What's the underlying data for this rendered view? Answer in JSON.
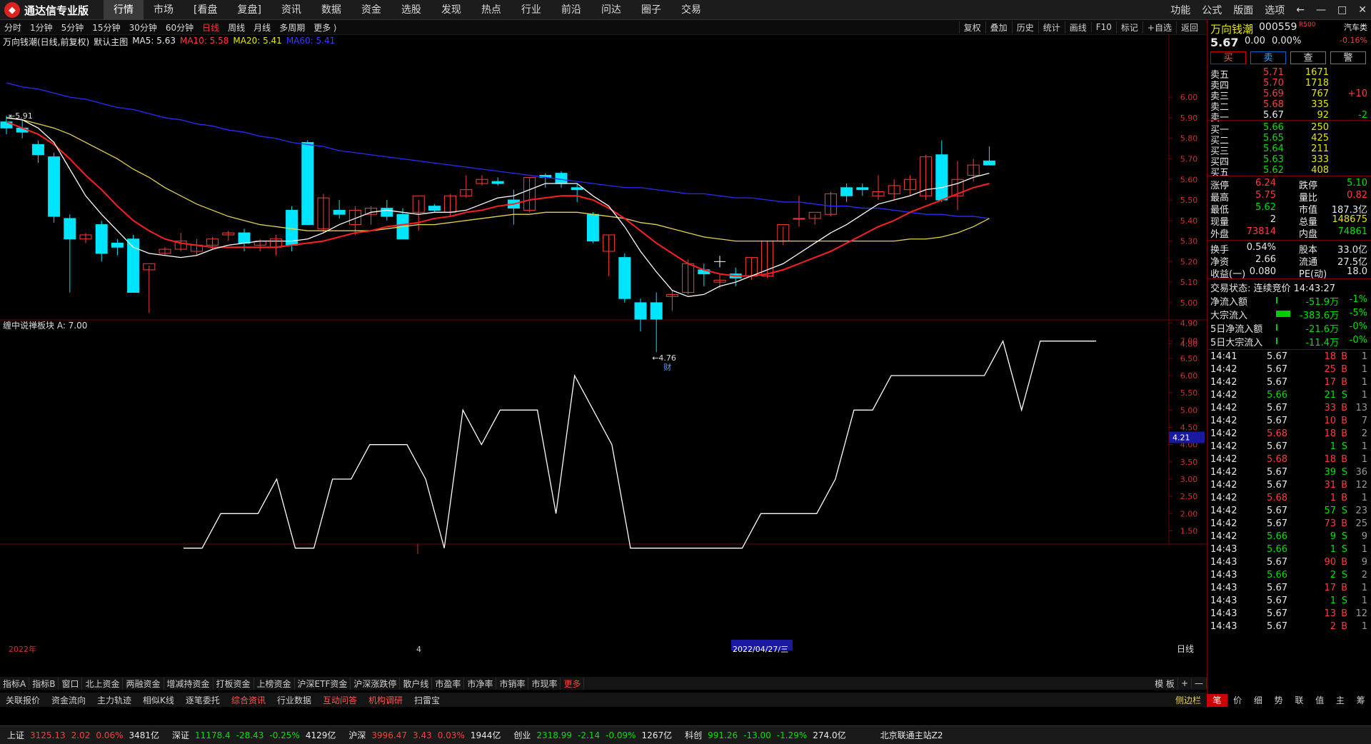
{
  "app": {
    "title": "通达信专业版"
  },
  "menu": [
    "行情",
    "市场",
    "[看盘",
    "复盘]",
    "资讯",
    "数据",
    "资金",
    "选股",
    "发现",
    "热点",
    "行业",
    "前沿",
    "问达",
    "圈子",
    "交易"
  ],
  "menu_active": "行情",
  "right_menu": [
    "功能",
    "公式",
    "版面",
    "选项",
    "←",
    "—",
    "□",
    "✕"
  ],
  "periods": [
    "分时",
    "1分钟",
    "5分钟",
    "15分钟",
    "30分钟",
    "60分钟",
    "日线",
    "周线",
    "月线",
    "多周期",
    "更多 ⟩"
  ],
  "period_active": "日线",
  "toolbar_right": [
    "复权",
    "叠加",
    "历史",
    "统计",
    "画线",
    "F10",
    "标记",
    "+自选",
    "返回"
  ],
  "chart_info": {
    "name": "万向钱潮(日线,前复权)",
    "main": "默认主图",
    "ma5": "MA5: 5.63",
    "ma10": "MA10: 5.58",
    "ma20": "MA20: 5.41",
    "ma60": "MA60: 5.41",
    "high_label": "5.91",
    "low_label": "4.76",
    "fin_mark": "财",
    "year_label": "2022年",
    "month_label": "4",
    "date_label": "2022/04/27/三",
    "period_label": "日线",
    "ind_title": "缠中说禅板块",
    "ind_value": "A: 7.00",
    "ind_cursor": "4.21"
  },
  "chart_data": [
    {
      "type": "candlestick",
      "title": "万向钱潮(日线,前复权)",
      "y_ticks": [
        "6.00",
        "5.90",
        "5.80",
        "5.70",
        "5.60",
        "5.50",
        "5.40",
        "5.30",
        "5.20",
        "5.10",
        "5.00",
        "4.90",
        "4.80"
      ],
      "ylim": [
        4.76,
        6.07
      ],
      "candles": [
        [
          5.88,
          5.91,
          5.82,
          5.85
        ],
        [
          5.85,
          5.89,
          5.8,
          5.83
        ],
        [
          5.77,
          5.79,
          5.68,
          5.72
        ],
        [
          5.71,
          5.73,
          5.39,
          5.42
        ],
        [
          5.41,
          5.43,
          5.05,
          5.31
        ],
        [
          5.31,
          5.34,
          5.29,
          5.33
        ],
        [
          5.38,
          5.4,
          5.2,
          5.24
        ],
        [
          5.29,
          5.31,
          5.23,
          5.27
        ],
        [
          5.31,
          5.33,
          5.05,
          5.05
        ],
        [
          5.16,
          5.18,
          4.95,
          5.19
        ],
        [
          5.24,
          5.27,
          5.23,
          5.26
        ],
        [
          5.26,
          5.34,
          5.25,
          5.3
        ],
        [
          5.25,
          5.31,
          5.23,
          5.28
        ],
        [
          5.28,
          5.32,
          5.26,
          5.31
        ],
        [
          5.33,
          5.35,
          5.3,
          5.34
        ],
        [
          5.34,
          5.36,
          5.25,
          5.29
        ],
        [
          5.28,
          5.31,
          5.25,
          5.3
        ],
        [
          5.27,
          5.33,
          5.23,
          5.31
        ],
        [
          5.45,
          5.47,
          5.25,
          5.28
        ],
        [
          5.78,
          5.79,
          5.38,
          5.38
        ],
        [
          5.36,
          5.53,
          5.34,
          5.51
        ],
        [
          5.45,
          5.5,
          5.41,
          5.43
        ],
        [
          5.38,
          5.47,
          5.33,
          5.45
        ],
        [
          5.43,
          5.47,
          5.38,
          5.46
        ],
        [
          5.46,
          5.5,
          5.4,
          5.42
        ],
        [
          5.43,
          5.46,
          5.31,
          5.31
        ],
        [
          5.44,
          5.5,
          5.35,
          5.52
        ],
        [
          5.47,
          5.48,
          5.44,
          5.45
        ],
        [
          5.44,
          5.53,
          5.42,
          5.52
        ],
        [
          5.52,
          5.62,
          5.51,
          5.55
        ],
        [
          5.58,
          5.62,
          5.57,
          5.6
        ],
        [
          5.59,
          5.61,
          5.57,
          5.58
        ],
        [
          5.5,
          5.55,
          5.38,
          5.46
        ],
        [
          5.45,
          5.61,
          5.44,
          5.61
        ],
        [
          5.62,
          5.63,
          5.56,
          5.61
        ],
        [
          5.63,
          5.64,
          5.56,
          5.58
        ],
        [
          5.56,
          5.58,
          5.49,
          5.55
        ],
        [
          5.43,
          5.44,
          5.29,
          5.3
        ],
        [
          5.25,
          5.33,
          5.13,
          5.33
        ],
        [
          5.22,
          5.24,
          5.0,
          5.02
        ],
        [
          5.0,
          5.02,
          4.86,
          4.92
        ],
        [
          5.0,
          5.05,
          4.76,
          4.92
        ],
        [
          5.03,
          5.06,
          4.96,
          5.04
        ],
        [
          5.05,
          5.21,
          5.04,
          5.19
        ],
        [
          5.16,
          5.19,
          5.08,
          5.14
        ],
        [
          5.1,
          5.14,
          5.07,
          5.11
        ],
        [
          5.14,
          5.17,
          5.08,
          5.12
        ],
        [
          5.13,
          5.22,
          5.11,
          5.22
        ],
        [
          5.13,
          5.3,
          5.12,
          5.3
        ],
        [
          5.3,
          5.37,
          5.28,
          5.38
        ],
        [
          5.41,
          5.52,
          5.37,
          5.41
        ],
        [
          5.41,
          5.43,
          5.38,
          5.44
        ],
        [
          5.43,
          5.54,
          5.42,
          5.53
        ],
        [
          5.56,
          5.58,
          5.49,
          5.52
        ],
        [
          5.56,
          5.58,
          5.52,
          5.55
        ],
        [
          5.52,
          5.62,
          5.5,
          5.54
        ],
        [
          5.53,
          5.6,
          5.5,
          5.57
        ],
        [
          5.55,
          5.62,
          5.52,
          5.6
        ],
        [
          5.52,
          5.72,
          5.5,
          5.71
        ],
        [
          5.72,
          5.79,
          5.49,
          5.5
        ],
        [
          5.52,
          5.69,
          5.45,
          5.6
        ],
        [
          5.62,
          5.7,
          5.59,
          5.67
        ],
        [
          5.69,
          5.76,
          5.67,
          5.67
        ]
      ],
      "ma5": [
        5.9,
        5.89,
        5.85,
        5.78,
        5.65,
        5.52,
        5.43,
        5.35,
        5.27,
        5.24,
        5.23,
        5.22,
        5.23,
        5.26,
        5.28,
        5.29,
        5.3,
        5.3,
        5.3,
        5.31,
        5.34,
        5.38,
        5.41,
        5.44,
        5.45,
        5.44,
        5.43,
        5.44,
        5.44,
        5.45,
        5.48,
        5.51,
        5.52,
        5.55,
        5.58,
        5.58,
        5.58,
        5.52,
        5.47,
        5.37,
        5.25,
        5.15,
        5.06,
        5.03,
        5.04,
        5.08,
        5.1,
        5.13,
        5.16,
        5.19,
        5.24,
        5.29,
        5.34,
        5.38,
        5.43,
        5.48,
        5.5,
        5.52,
        5.55,
        5.56,
        5.58,
        5.61,
        5.63
      ],
      "ma10": [
        5.88,
        5.85,
        5.82,
        5.77,
        5.7,
        5.62,
        5.55,
        5.47,
        5.4,
        5.35,
        5.31,
        5.29,
        5.28,
        5.27,
        5.27,
        5.27,
        5.27,
        5.27,
        5.28,
        5.29,
        5.3,
        5.32,
        5.34,
        5.35,
        5.37,
        5.38,
        5.39,
        5.41,
        5.42,
        5.44,
        5.45,
        5.47,
        5.48,
        5.5,
        5.51,
        5.52,
        5.52,
        5.5,
        5.46,
        5.41,
        5.35,
        5.29,
        5.24,
        5.19,
        5.16,
        5.14,
        5.13,
        5.13,
        5.14,
        5.16,
        5.19,
        5.22,
        5.25,
        5.29,
        5.33,
        5.37,
        5.4,
        5.44,
        5.47,
        5.5,
        5.53,
        5.56,
        5.58
      ],
      "ma20": [
        5.9,
        5.89,
        5.87,
        5.85,
        5.82,
        5.78,
        5.74,
        5.7,
        5.65,
        5.61,
        5.56,
        5.52,
        5.48,
        5.45,
        5.42,
        5.4,
        5.38,
        5.37,
        5.36,
        5.35,
        5.35,
        5.35,
        5.35,
        5.35,
        5.36,
        5.37,
        5.38,
        5.38,
        5.39,
        5.4,
        5.41,
        5.42,
        5.43,
        5.43,
        5.44,
        5.44,
        5.44,
        5.43,
        5.42,
        5.41,
        5.39,
        5.38,
        5.36,
        5.34,
        5.32,
        5.31,
        5.3,
        5.3,
        5.3,
        5.3,
        5.3,
        5.3,
        5.3,
        5.3,
        5.3,
        5.3,
        5.3,
        5.31,
        5.31,
        5.32,
        5.34,
        5.37,
        5.41
      ],
      "ma60": [
        6.07,
        6.05,
        6.04,
        6.02,
        6.0,
        5.99,
        5.97,
        5.95,
        5.94,
        5.92,
        5.9,
        5.89,
        5.87,
        5.86,
        5.84,
        5.83,
        5.81,
        5.8,
        5.78,
        5.77,
        5.76,
        5.74,
        5.73,
        5.72,
        5.71,
        5.7,
        5.69,
        5.68,
        5.67,
        5.66,
        5.65,
        5.64,
        5.63,
        5.62,
        5.61,
        5.6,
        5.59,
        5.58,
        5.57,
        5.56,
        5.56,
        5.55,
        5.54,
        5.53,
        5.53,
        5.52,
        5.51,
        5.51,
        5.5,
        5.49,
        5.49,
        5.48,
        5.47,
        5.47,
        5.46,
        5.46,
        5.45,
        5.44,
        5.43,
        5.43,
        5.42,
        5.42,
        5.41
      ]
    },
    {
      "type": "line",
      "title": "缠中说禅板块",
      "y_ticks": [
        "7.00",
        "6.50",
        "6.00",
        "5.50",
        "5.00",
        "4.50",
        "4.00",
        "3.50",
        "3.00",
        "2.50",
        "2.00",
        "1.50"
      ],
      "ylim": [
        1.2,
        7.2
      ],
      "series": [
        {
          "values": [
            null,
            null,
            null,
            null,
            null,
            null,
            null,
            null,
            null,
            1.0,
            1.0,
            2.0,
            2.0,
            2.0,
            3.0,
            1.0,
            1.0,
            3.0,
            3.0,
            4.0,
            4.0,
            4.0,
            3.0,
            1.0,
            5.0,
            4.0,
            5.0,
            5.0,
            5.0,
            2.0,
            6.0,
            5.0,
            4.0,
            1.0,
            1.0,
            1.0,
            1.0,
            1.0,
            1.0,
            1.0,
            2.0,
            2.0,
            2.0,
            2.0,
            3.0,
            5.0,
            5.0,
            6.0,
            6.0,
            6.0,
            6.0,
            6.0,
            6.0,
            7.0,
            5.0,
            7.0,
            7.0,
            7.0,
            7.0
          ]
        }
      ]
    }
  ],
  "quote": {
    "name": "万向钱潮",
    "code": "000559",
    "tag": "R500",
    "sector": "汽车类",
    "sector_pct": "-0.16%",
    "price": "5.67",
    "chg": "0.00",
    "pct": "0.00%",
    "buttons": [
      "买",
      "卖",
      "查",
      "警"
    ],
    "sell": [
      {
        "label": "卖五",
        "price": "5.71",
        "vol": "1671",
        "delta": ""
      },
      {
        "label": "卖四",
        "price": "5.70",
        "vol": "1718",
        "delta": ""
      },
      {
        "label": "卖三",
        "price": "5.69",
        "vol": "767",
        "delta": "+10"
      },
      {
        "label": "卖二",
        "price": "5.68",
        "vol": "335",
        "delta": ""
      },
      {
        "label": "卖一",
        "price": "5.67",
        "vol": "92",
        "delta": "-2"
      }
    ],
    "buy": [
      {
        "label": "买一",
        "price": "5.66",
        "vol": "250"
      },
      {
        "label": "买二",
        "price": "5.65",
        "vol": "425"
      },
      {
        "label": "买三",
        "price": "5.64",
        "vol": "211"
      },
      {
        "label": "买四",
        "price": "5.63",
        "vol": "333"
      },
      {
        "label": "买五",
        "price": "5.62",
        "vol": "408"
      }
    ],
    "stats": [
      [
        "涨停",
        "6.24",
        "跌停",
        "5.10"
      ],
      [
        "最高",
        "5.75",
        "量比",
        "0.82"
      ],
      [
        "最低",
        "5.62",
        "市值",
        "187.3亿"
      ],
      [
        "现量",
        "2",
        "总量",
        "148675"
      ],
      [
        "外盘",
        "73814",
        "内盘",
        "74861"
      ]
    ],
    "stats2": [
      [
        "换手",
        "0.54%",
        "股本",
        "33.0亿"
      ],
      [
        "净资",
        "2.66",
        "流通",
        "27.5亿"
      ],
      [
        "收益(一)",
        "0.080",
        "PE(动)",
        "18.0"
      ]
    ],
    "trade_status": "交易状态: 连续竞价 14:43:27",
    "flows": [
      {
        "label": "净流入额",
        "value": "-51.9万",
        "pct": "-1%",
        "level": 0.02
      },
      {
        "label": "大宗流入",
        "value": "-383.6万",
        "pct": "-5%",
        "level": 0.45
      },
      {
        "label": "5日净流入额",
        "value": "-21.6万",
        "pct": "-0%",
        "level": 0.02
      },
      {
        "label": "5日大宗流入",
        "value": "-11.4万",
        "pct": "-0%",
        "level": 0.02
      }
    ],
    "ticks": [
      [
        "14:41",
        "5.67",
        "18",
        "B",
        "1"
      ],
      [
        "14:42",
        "5.67",
        "25",
        "B",
        "1"
      ],
      [
        "14:42",
        "5.67",
        "17",
        "B",
        "1"
      ],
      [
        "14:42",
        "5.66",
        "21",
        "S",
        "1"
      ],
      [
        "14:42",
        "5.67",
        "33",
        "B",
        "13"
      ],
      [
        "14:42",
        "5.67",
        "10",
        "B",
        "7"
      ],
      [
        "14:42",
        "5.68",
        "18",
        "B",
        "2"
      ],
      [
        "14:42",
        "5.67",
        "1",
        "S",
        "1"
      ],
      [
        "14:42",
        "5.68",
        "18",
        "B",
        "1"
      ],
      [
        "14:42",
        "5.67",
        "39",
        "S",
        "36"
      ],
      [
        "14:42",
        "5.67",
        "31",
        "B",
        "12"
      ],
      [
        "14:42",
        "5.68",
        "1",
        "B",
        "1"
      ],
      [
        "14:42",
        "5.67",
        "57",
        "S",
        "23"
      ],
      [
        "14:42",
        "5.67",
        "73",
        "B",
        "25"
      ],
      [
        "14:42",
        "5.66",
        "9",
        "S",
        "9"
      ],
      [
        "14:43",
        "5.66",
        "1",
        "S",
        "1"
      ],
      [
        "14:43",
        "5.67",
        "90",
        "B",
        "9"
      ],
      [
        "14:43",
        "5.66",
        "2",
        "S",
        "2"
      ],
      [
        "14:43",
        "5.67",
        "17",
        "B",
        "1"
      ],
      [
        "14:43",
        "5.67",
        "1",
        "S",
        "1"
      ],
      [
        "14:43",
        "5.67",
        "13",
        "B",
        "12"
      ],
      [
        "14:43",
        "5.67",
        "2",
        "B",
        "1"
      ]
    ]
  },
  "tabs_indicator": [
    "指标A",
    "指标B",
    "窗口",
    "北上资金",
    "两融资金",
    "增减持资金",
    "打板资金",
    "上榜资金",
    "沪深ETF资金",
    "沪深涨跌停",
    "散户线",
    "市盈率",
    "市净率",
    "市销率",
    "市现率",
    "更多"
  ],
  "tabs_indicator_right": [
    "模 板",
    "+",
    "—"
  ],
  "tabs_info": [
    "关联报价",
    "资金流向",
    "主力轨迹",
    "相似K线",
    "逐笔委托",
    "综合资讯",
    "行业数据",
    "互动问答",
    "机构调研",
    "扫雷宝"
  ],
  "tabs_info_right": "侧边栏",
  "side_tabs": [
    "笔",
    "价",
    "细",
    "势",
    "联",
    "值",
    "主",
    "筹"
  ],
  "status": {
    "sh": [
      "上证",
      "3125.13",
      "2.02",
      "0.06%",
      "3481亿"
    ],
    "sz": [
      "深证",
      "11178.4",
      "-28.43",
      "-0.25%",
      "4129亿"
    ],
    "hs": [
      "沪深",
      "3996.47",
      "3.43",
      "0.03%",
      "1944亿"
    ],
    "cy": [
      "创业",
      "2318.99",
      "-2.14",
      "-0.09%",
      "1267亿"
    ],
    "kc": [
      "科创",
      "991.26",
      "-13.00",
      "-1.29%",
      "274.0亿"
    ],
    "server": "北京联通主站Z2"
  },
  "colors": {
    "up": "#ff3b3b",
    "down": "#00e5ff",
    "ma5": "#ffffff",
    "ma10": "#ff2020",
    "ma20": "#e6d24a",
    "ma60": "#2a2aff",
    "grid": "#7a0000"
  }
}
